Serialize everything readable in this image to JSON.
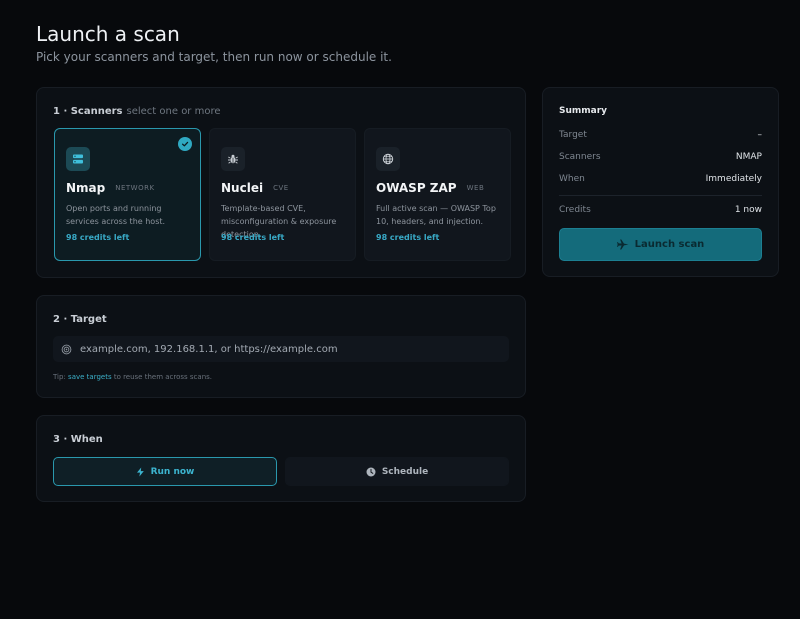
{
  "header": {
    "title": "Launch a scan",
    "subtitle": "Pick your scanners and target, then run now or schedule it."
  },
  "scanners": {
    "heading": "1 · Scanners",
    "hint": "select one or more",
    "cards": [
      {
        "name": "Nmap",
        "tag": "NETWORK",
        "desc": "Open ports and running services across the host.",
        "credits": "98 credits left",
        "selected": true,
        "icon": "server-icon"
      },
      {
        "name": "Nuclei",
        "tag": "CVE",
        "desc": "Template-based CVE, misconfiguration & exposure detection.",
        "credits": "98 credits left",
        "selected": false,
        "icon": "bug-icon"
      },
      {
        "name": "OWASP ZAP",
        "tag": "WEB",
        "desc": "Full active scan — OWASP Top 10, headers, and injection.",
        "credits": "98 credits left",
        "selected": false,
        "icon": "globe-icon"
      }
    ]
  },
  "target": {
    "heading": "2 · Target",
    "placeholder": "example.com, 192.168.1.1, or https://example.com",
    "value": "",
    "tip_prefix": "Tip: ",
    "tip_link": "save targets",
    "tip_suffix": " to reuse them across scans."
  },
  "when": {
    "heading": "3 · When",
    "run_now_label": "Run now",
    "schedule_label": "Schedule",
    "selected": "run_now"
  },
  "summary": {
    "title": "Summary",
    "target_label": "Target",
    "target_value": "–",
    "scanners_label": "Scanners",
    "scanners_value": "NMAP",
    "when_label": "When",
    "when_value": "Immediately",
    "credits_label": "Credits",
    "credits_value": "1 now",
    "launch_label": "Launch scan"
  },
  "colors": {
    "accent": "#2fa9c2",
    "background": "#07090c",
    "panel": "#0c1015",
    "launch_button": "#146b7b"
  }
}
